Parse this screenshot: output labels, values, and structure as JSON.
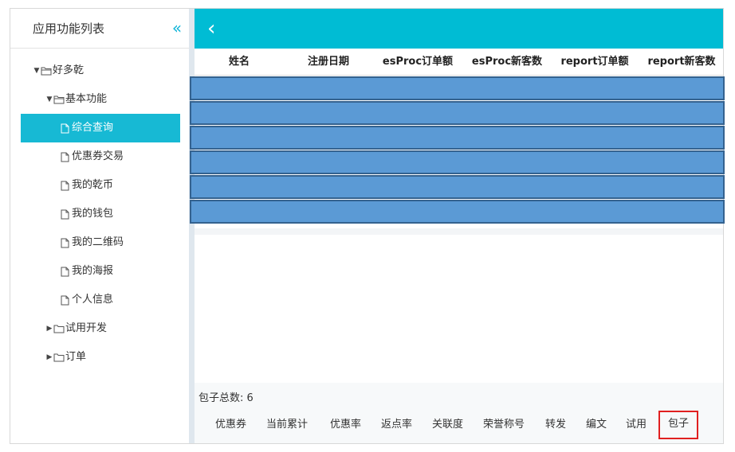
{
  "sidebar": {
    "title": "应用功能列表",
    "collapse_icon": "«",
    "tree": [
      {
        "label": "好多乾",
        "type": "folder",
        "expanded": true,
        "level": 0
      },
      {
        "label": "基本功能",
        "type": "folder",
        "expanded": true,
        "level": 1
      },
      {
        "label": "综合查询",
        "type": "file",
        "level": 2,
        "selected": true
      },
      {
        "label": "优惠券交易",
        "type": "file",
        "level": 2
      },
      {
        "label": "我的乾币",
        "type": "file",
        "level": 2
      },
      {
        "label": "我的钱包",
        "type": "file",
        "level": 2
      },
      {
        "label": "我的二维码",
        "type": "file",
        "level": 2
      },
      {
        "label": "我的海报",
        "type": "file",
        "level": 2
      },
      {
        "label": "个人信息",
        "type": "file",
        "level": 2
      },
      {
        "label": "试用开发",
        "type": "folder",
        "expanded": false,
        "level": 1
      },
      {
        "label": "订单",
        "type": "folder",
        "expanded": false,
        "level": 1
      }
    ]
  },
  "topbar": {
    "back_icon": "‹",
    "color": "#00bcd4"
  },
  "table": {
    "columns": [
      "姓名",
      "注册日期",
      "esProc订单额",
      "esProc新客数",
      "report订单额",
      "report新客数"
    ],
    "row_count": 6,
    "row_color": "#5b9ad5"
  },
  "footer": {
    "total_label": "包子总数: 6",
    "tabs": [
      "优惠券",
      "当前累计",
      "优惠率",
      "返点率",
      "关联度",
      "荣誉称号",
      "转发",
      "编文",
      "试用",
      "包子"
    ],
    "active_tab": "包子"
  }
}
